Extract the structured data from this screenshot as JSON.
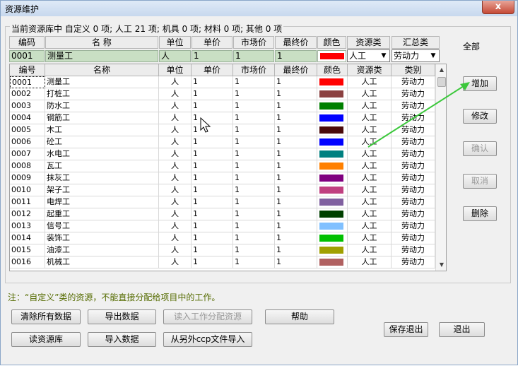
{
  "window": {
    "title": "资源维护",
    "close_label": "x"
  },
  "summary": "当前资源库中 自定义 0 项; 人工 21 项; 机具 0 项; 材料 0 项; 其他 0 项",
  "all_label": "全部",
  "editor": {
    "headers": [
      "编码",
      "名    称",
      "单位",
      "单价",
      "市场价",
      "最终价",
      "颜色",
      "资源类",
      "汇总类"
    ],
    "code": "0001",
    "name": "测量工",
    "unit": "人",
    "price": "1",
    "market": "1",
    "final": "1",
    "color": "#ff0000",
    "resource_type": "人工",
    "summary_type": "劳动力"
  },
  "grid": {
    "headers": [
      "编号",
      "名称",
      "单位",
      "单价",
      "市场价",
      "最终价",
      "颜色",
      "资源类",
      "类别"
    ],
    "rows": [
      {
        "code": "0001",
        "name": "测量工",
        "unit": "人",
        "price": "1",
        "market": "1",
        "final": "1",
        "color": "#ff0000",
        "type": "人工",
        "category": "劳动力"
      },
      {
        "code": "0002",
        "name": "打桩工",
        "unit": "人",
        "price": "1",
        "market": "1",
        "final": "1",
        "color": "#8b4040",
        "type": "人工",
        "category": "劳动力"
      },
      {
        "code": "0003",
        "name": "防水工",
        "unit": "人",
        "price": "1",
        "market": "1",
        "final": "1",
        "color": "#008000",
        "type": "人工",
        "category": "劳动力"
      },
      {
        "code": "0004",
        "name": "钢筋工",
        "unit": "人",
        "price": "1",
        "market": "1",
        "final": "1",
        "color": "#0000ff",
        "type": "人工",
        "category": "劳动力"
      },
      {
        "code": "0005",
        "name": "木工",
        "unit": "人",
        "price": "1",
        "market": "1",
        "final": "1",
        "color": "#4a0a0a",
        "type": "人工",
        "category": "劳动力"
      },
      {
        "code": "0006",
        "name": "砼工",
        "unit": "人",
        "price": "1",
        "market": "1",
        "final": "1",
        "color": "#0000ff",
        "type": "人工",
        "category": "劳动力"
      },
      {
        "code": "0007",
        "name": "水电工",
        "unit": "人",
        "price": "1",
        "market": "1",
        "final": "1",
        "color": "#008080",
        "type": "人工",
        "category": "劳动力"
      },
      {
        "code": "0008",
        "name": "瓦工",
        "unit": "人",
        "price": "1",
        "market": "1",
        "final": "1",
        "color": "#ff8000",
        "type": "人工",
        "category": "劳动力"
      },
      {
        "code": "0009",
        "name": "抹灰工",
        "unit": "人",
        "price": "1",
        "market": "1",
        "final": "1",
        "color": "#800080",
        "type": "人工",
        "category": "劳动力"
      },
      {
        "code": "0010",
        "name": "架子工",
        "unit": "人",
        "price": "1",
        "market": "1",
        "final": "1",
        "color": "#c04080",
        "type": "人工",
        "category": "劳动力"
      },
      {
        "code": "0011",
        "name": "电焊工",
        "unit": "人",
        "price": "1",
        "market": "1",
        "final": "1",
        "color": "#8060a0",
        "type": "人工",
        "category": "劳动力"
      },
      {
        "code": "0012",
        "name": "起重工",
        "unit": "人",
        "price": "1",
        "market": "1",
        "final": "1",
        "color": "#004000",
        "type": "人工",
        "category": "劳动力"
      },
      {
        "code": "0013",
        "name": "信号工",
        "unit": "人",
        "price": "1",
        "market": "1",
        "final": "1",
        "color": "#80c0ff",
        "type": "人工",
        "category": "劳动力"
      },
      {
        "code": "0014",
        "name": "装饰工",
        "unit": "人",
        "price": "1",
        "market": "1",
        "final": "1",
        "color": "#00c000",
        "type": "人工",
        "category": "劳动力"
      },
      {
        "code": "0015",
        "name": "油漆工",
        "unit": "人",
        "price": "1",
        "market": "1",
        "final": "1",
        "color": "#a0a000",
        "type": "人工",
        "category": "劳动力"
      },
      {
        "code": "0016",
        "name": "机械工",
        "unit": "人",
        "price": "1",
        "market": "1",
        "final": "1",
        "color": "#b06060",
        "type": "人工",
        "category": "劳动力"
      }
    ]
  },
  "side_buttons": {
    "add": "增加",
    "modify": "修改",
    "confirm": "确认",
    "cancel": "取消",
    "delete": "删除"
  },
  "note": "注：“自定义”类的资源，不能直接分配给项目中的工作。",
  "buttons": {
    "clear_all": "清除所有数据",
    "export": "导出数据",
    "read_assign": "读入工作分配资源",
    "help": "帮助",
    "read_library": "读资源库",
    "import": "导入数据",
    "import_ccp": "从另外ccp文件导入",
    "save_exit": "保存退出",
    "exit": "退出"
  }
}
